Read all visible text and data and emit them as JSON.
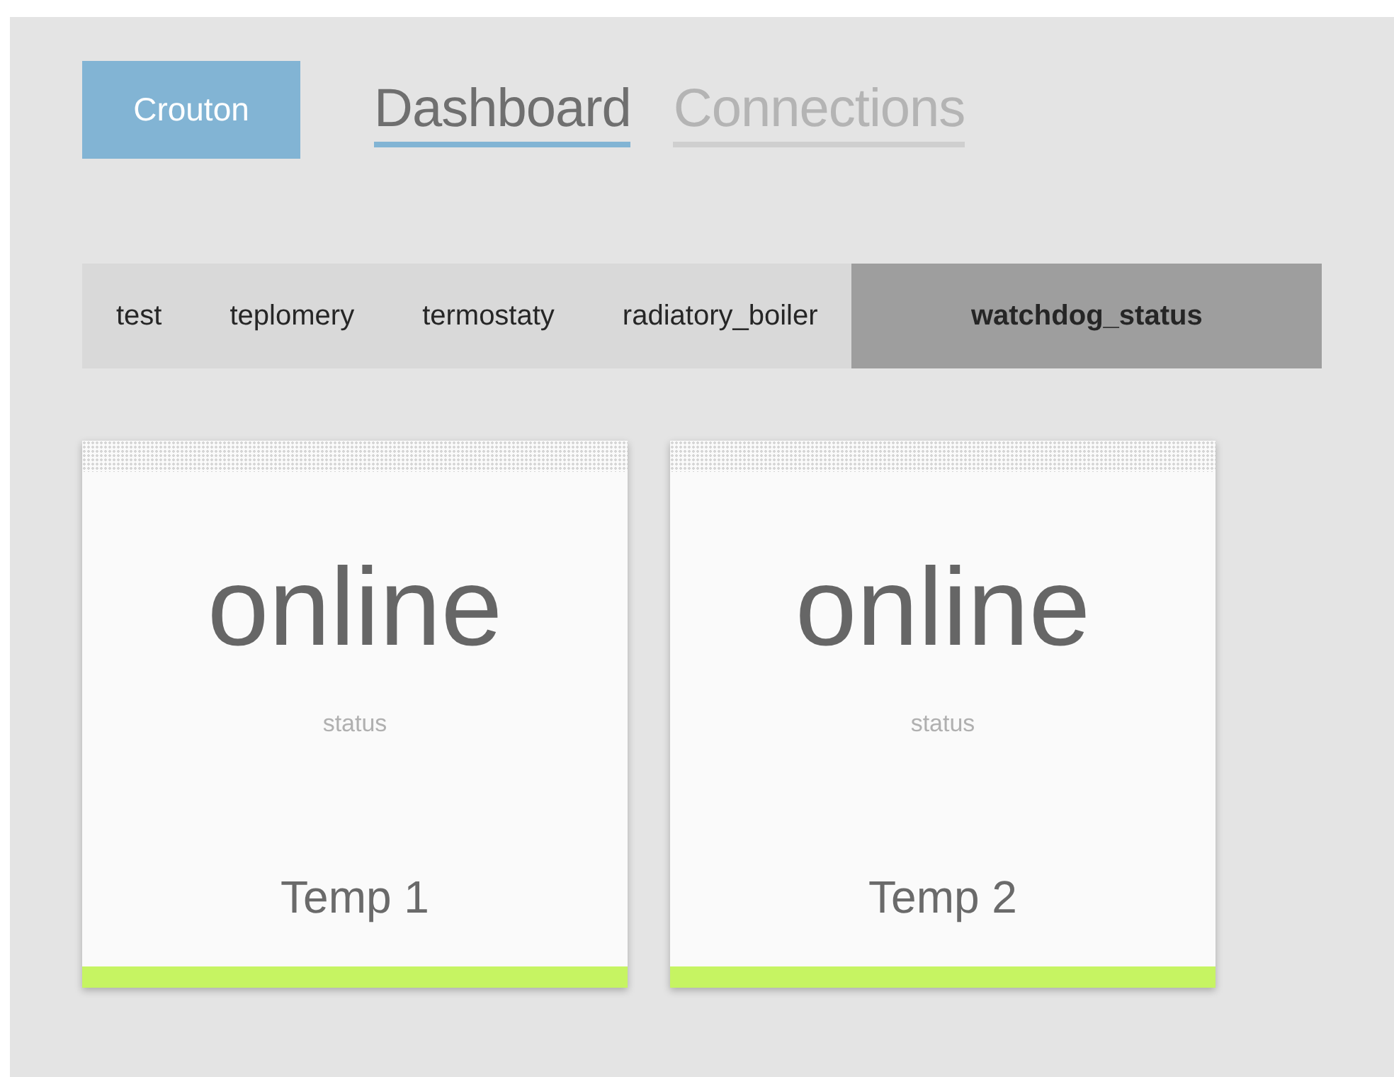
{
  "brand": "Crouton",
  "nav_tabs": [
    {
      "label": "Dashboard",
      "selected": true
    },
    {
      "label": "Connections",
      "selected": false
    }
  ],
  "group_tabs": [
    {
      "label": "test",
      "selected": false
    },
    {
      "label": "teplomery",
      "selected": false
    },
    {
      "label": "termostaty",
      "selected": false
    },
    {
      "label": "radiatory_boiler",
      "selected": false
    },
    {
      "label": "watchdog_status",
      "selected": true
    }
  ],
  "cards": [
    {
      "value": "online",
      "label": "status",
      "title": "Temp 1",
      "color": "#c6f462"
    },
    {
      "value": "online",
      "label": "status",
      "title": "Temp 2",
      "color": "#c6f462"
    }
  ]
}
